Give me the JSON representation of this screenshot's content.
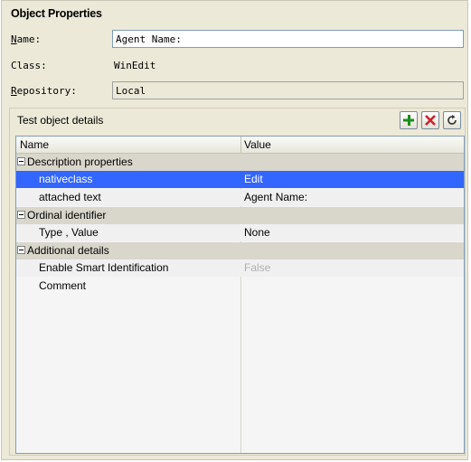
{
  "panel": {
    "title": "Object Properties"
  },
  "fields": {
    "name_label_u": "N",
    "name_label_rest": "ame:",
    "name_value": "Agent Name:",
    "class_label": "Class:",
    "class_value": "WinEdit",
    "repository_label_u": "R",
    "repository_label_rest": "epository:",
    "repository_value": "Local"
  },
  "details": {
    "title": "Test object details",
    "toolbar": [
      {
        "icon": "plus-icon",
        "color": "#1a8f1a"
      },
      {
        "icon": "delete-x-icon",
        "color": "#d0202a"
      },
      {
        "icon": "refresh-icon",
        "color": "#333333"
      }
    ],
    "columns": {
      "name": "Name",
      "value": "Value"
    },
    "rows": [
      {
        "type": "category",
        "name": "Description properties",
        "value": ""
      },
      {
        "type": "property",
        "name": "nativeclass",
        "value": "Edit",
        "selected": true
      },
      {
        "type": "property",
        "name": "attached text",
        "value": "Agent Name:"
      },
      {
        "type": "category",
        "name": "Ordinal identifier",
        "value": ""
      },
      {
        "type": "property",
        "name": "Type , Value",
        "value": "None"
      },
      {
        "type": "category",
        "name": "Additional details",
        "value": ""
      },
      {
        "type": "property",
        "name": "Enable Smart Identification",
        "value": "False",
        "disabled": true
      },
      {
        "type": "property",
        "name": "Comment",
        "value": ""
      }
    ]
  },
  "colors": {
    "panel_bg": "#ece9d8",
    "selection": "#3366ff",
    "category_bg": "#d9d6cb"
  }
}
